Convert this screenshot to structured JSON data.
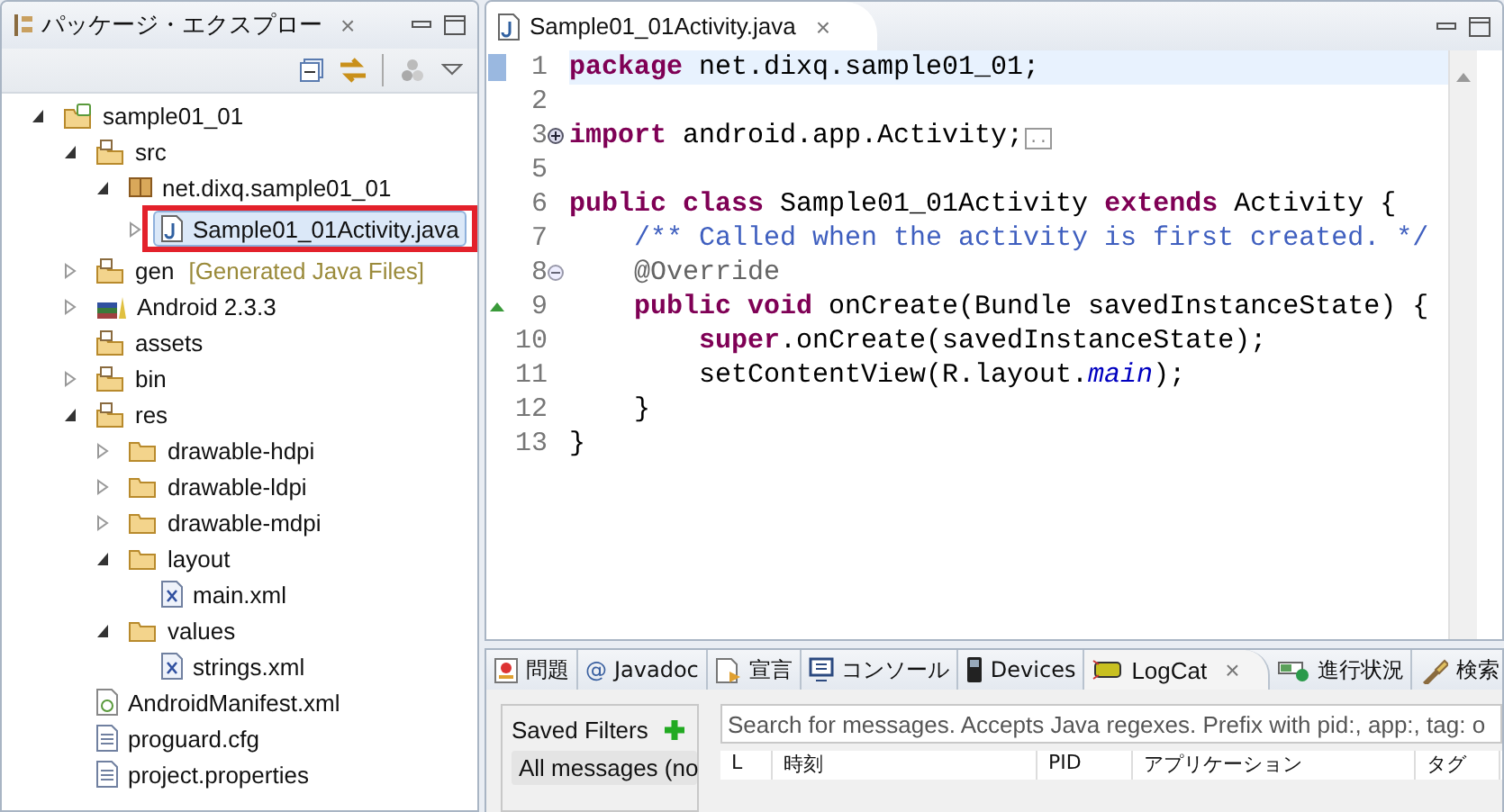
{
  "explorer": {
    "title": "パッケージ・エクスプロー",
    "close": "×",
    "tree": [
      {
        "label": "sample01_01",
        "kind": "project",
        "expanded": true,
        "selected": false,
        "children": [
          {
            "label": "src",
            "kind": "src-folder",
            "expanded": true,
            "selected": false,
            "children": [
              {
                "label": "net.dixq.sample01_01",
                "kind": "package",
                "expanded": true,
                "selected": false,
                "children": [
                  {
                    "label": "Sample01_01Activity.java",
                    "kind": "java-file",
                    "expanded": false,
                    "selected": true,
                    "highlighted": true
                  }
                ]
              }
            ]
          },
          {
            "label": "gen",
            "decoration": "[Generated Java Files]",
            "kind": "src-folder",
            "expanded": false,
            "selected": false
          },
          {
            "label": "Android 2.3.3",
            "kind": "library",
            "expanded": false,
            "selected": false
          },
          {
            "label": "assets",
            "kind": "src-folder",
            "selected": false
          },
          {
            "label": "bin",
            "kind": "src-folder",
            "expanded": false,
            "selected": false
          },
          {
            "label": "res",
            "kind": "src-folder",
            "expanded": true,
            "selected": false,
            "children": [
              {
                "label": "drawable-hdpi",
                "kind": "folder",
                "expanded": false,
                "selected": false
              },
              {
                "label": "drawable-ldpi",
                "kind": "folder",
                "expanded": false,
                "selected": false
              },
              {
                "label": "drawable-mdpi",
                "kind": "folder",
                "expanded": false,
                "selected": false
              },
              {
                "label": "layout",
                "kind": "folder",
                "expanded": true,
                "selected": false,
                "children": [
                  {
                    "label": "main.xml",
                    "kind": "xml-file",
                    "selected": false
                  }
                ]
              },
              {
                "label": "values",
                "kind": "folder",
                "expanded": true,
                "selected": false,
                "children": [
                  {
                    "label": "strings.xml",
                    "kind": "xml-file",
                    "selected": false
                  }
                ]
              }
            ]
          },
          {
            "label": "AndroidManifest.xml",
            "kind": "manifest",
            "selected": false
          },
          {
            "label": "proguard.cfg",
            "kind": "text-file",
            "selected": false
          },
          {
            "label": "project.properties",
            "kind": "text-file",
            "selected": false
          }
        ]
      }
    ]
  },
  "editor": {
    "tab": "Sample01_01Activity.java",
    "close": "×",
    "lines": [
      {
        "number": "1",
        "kind": "plain",
        "current": true,
        "tokens": [
          {
            "kind": "keyword",
            "text": "package"
          },
          {
            "kind": "plain",
            "text": " net.dixq.sample01_01;"
          }
        ]
      },
      {
        "number": "2",
        "kind": "plain"
      },
      {
        "number": "3",
        "kind": "folded",
        "current": false,
        "tokens": [
          {
            "kind": "keyword",
            "text": "import"
          },
          {
            "kind": "plain",
            "text": " android.app.Activity;"
          },
          {
            "kind": "folded",
            "text": ".."
          }
        ]
      },
      {
        "number": "5",
        "kind": "plain"
      },
      {
        "number": "6",
        "kind": "plain",
        "current": false,
        "tokens": [
          {
            "kind": "keyword",
            "text": "public class"
          },
          {
            "kind": "plain",
            "text": " Sample01_01Activity "
          },
          {
            "kind": "keyword",
            "text": "extends"
          },
          {
            "kind": "plain",
            "text": " Activity {"
          }
        ]
      },
      {
        "number": "7",
        "kind": "plain",
        "current": false,
        "tokens": [
          {
            "kind": "comment",
            "text": "    /** Called when the activity is first created. */"
          }
        ]
      },
      {
        "number": "8",
        "kind": "foldable",
        "current": false,
        "tokens": [
          {
            "kind": "annotation",
            "text": "    @Override"
          }
        ]
      },
      {
        "number": "9",
        "kind": "override",
        "current": false,
        "tokens": [
          {
            "kind": "keyword",
            "text": "    public void"
          },
          {
            "kind": "plain",
            "text": " onCreate(Bundle savedInstanceState) {"
          }
        ]
      },
      {
        "number": "10",
        "kind": "plain",
        "current": false,
        "tokens": [
          {
            "kind": "keyword",
            "text": "        super"
          },
          {
            "kind": "plain",
            "text": ".onCreate(savedInstanceState);"
          }
        ]
      },
      {
        "number": "11",
        "kind": "plain",
        "current": false,
        "tokens": [
          {
            "kind": "plain",
            "text": "        setContentView(R.layout."
          },
          {
            "kind": "field",
            "text": "main"
          },
          {
            "kind": "plain",
            "text": ");"
          }
        ]
      },
      {
        "number": "12",
        "kind": "plain",
        "current": false,
        "tokens": [
          {
            "kind": "plain",
            "text": "    }"
          }
        ]
      },
      {
        "number": "13",
        "kind": "plain",
        "current": false,
        "tokens": [
          {
            "kind": "plain",
            "text": "}"
          }
        ]
      }
    ]
  },
  "bottom_panel": {
    "tabs": [
      {
        "label": "問題",
        "kind": "problems",
        "selected": false
      },
      {
        "label": "Javadoc",
        "kind": "javadoc",
        "icon_text": "@",
        "selected": false
      },
      {
        "label": "宣言",
        "kind": "declaration",
        "selected": false
      },
      {
        "label": "コンソール",
        "kind": "console",
        "selected": false
      },
      {
        "label": "Devices",
        "kind": "devices",
        "selected": false
      },
      {
        "label": "LogCat",
        "kind": "logcat",
        "selected": true
      },
      {
        "label": "進行状況",
        "kind": "progress",
        "selected": false
      },
      {
        "label": "検索",
        "kind": "search",
        "selected": false
      }
    ],
    "close": "×",
    "saved_filters": {
      "title": "Saved Filters",
      "items": [
        {
          "label": "All messages (no",
          "selected": true
        }
      ]
    },
    "search": {
      "placeholder": "Search for messages. Accepts Java regexes. Prefix with pid:, app:, tag: o"
    },
    "columns": [
      "L",
      "時刻",
      "PID",
      "アプリケーション",
      "タグ"
    ]
  }
}
